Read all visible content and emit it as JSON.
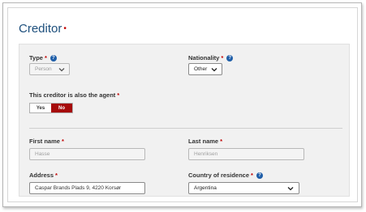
{
  "section": {
    "title": "Creditor",
    "required_mark": "•"
  },
  "type_field": {
    "label": "Type",
    "required": "*",
    "value": "Person"
  },
  "nationality_field": {
    "label": "Nationality",
    "required": "*",
    "value": "Other"
  },
  "agent_toggle": {
    "label": "This creditor is also the agent",
    "required": "*",
    "yes_label": "Yes",
    "no_label": "No",
    "selected": "No"
  },
  "first_name": {
    "label": "First name",
    "required": "*",
    "value": "Hasse"
  },
  "last_name": {
    "label": "Last name",
    "required": "*",
    "value": "Henriksen"
  },
  "address": {
    "label": "Address",
    "required": "*",
    "value": "Caspar Brands Plads 9, 4220 Korsør"
  },
  "country": {
    "label": "Country of residence",
    "required": "*",
    "value": "Argentina"
  },
  "icons": {
    "help": "?",
    "dropdown": "chevron-down-icon"
  }
}
